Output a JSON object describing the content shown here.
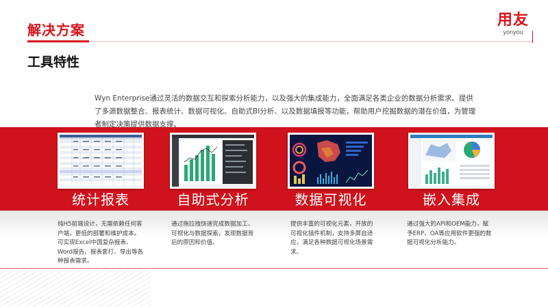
{
  "header": {
    "title": "解决方案",
    "logo_main": "用友",
    "logo_sub": "yonyou"
  },
  "section_title": "工具特性",
  "intro": "Wyn Enterprise通过灵活的数据交互和探索分析能力，以及强大的集成能力，全面满足各类企业的数据分析需求。提供了多源数据整合、报表统计、数据可视化、自助式BI分析、以及数据填报等功能，帮助用户挖掘数据的潜在价值，为管理者制定决策提供数据支撑。",
  "features": [
    {
      "title": "统计报表",
      "desc": "纯H5前端设计，无需依赖任何客户端，更低的部署和维护成本。可实现Excel中国复杂报表、Word报告、报表套打、导出等各种报表需求。"
    },
    {
      "title": "自助式分析",
      "desc": "通过拖拉拽快速完成数据加工、可视化与数据探索，发现数据背后的原因和价值。"
    },
    {
      "title": "数据可视化",
      "desc": "提供丰富的可视化元素，开放的可视化插件机制，支持多屏自适应，满足各种数据可视化场景需求。"
    },
    {
      "title": "嵌入集成",
      "desc": "通过强大的API和OEM能力，赋予ERP、OA等应用软件更强的数据可视化分析能力。"
    }
  ],
  "colors": {
    "brand_red": "#d0121c",
    "title_red": "#d9141e"
  }
}
